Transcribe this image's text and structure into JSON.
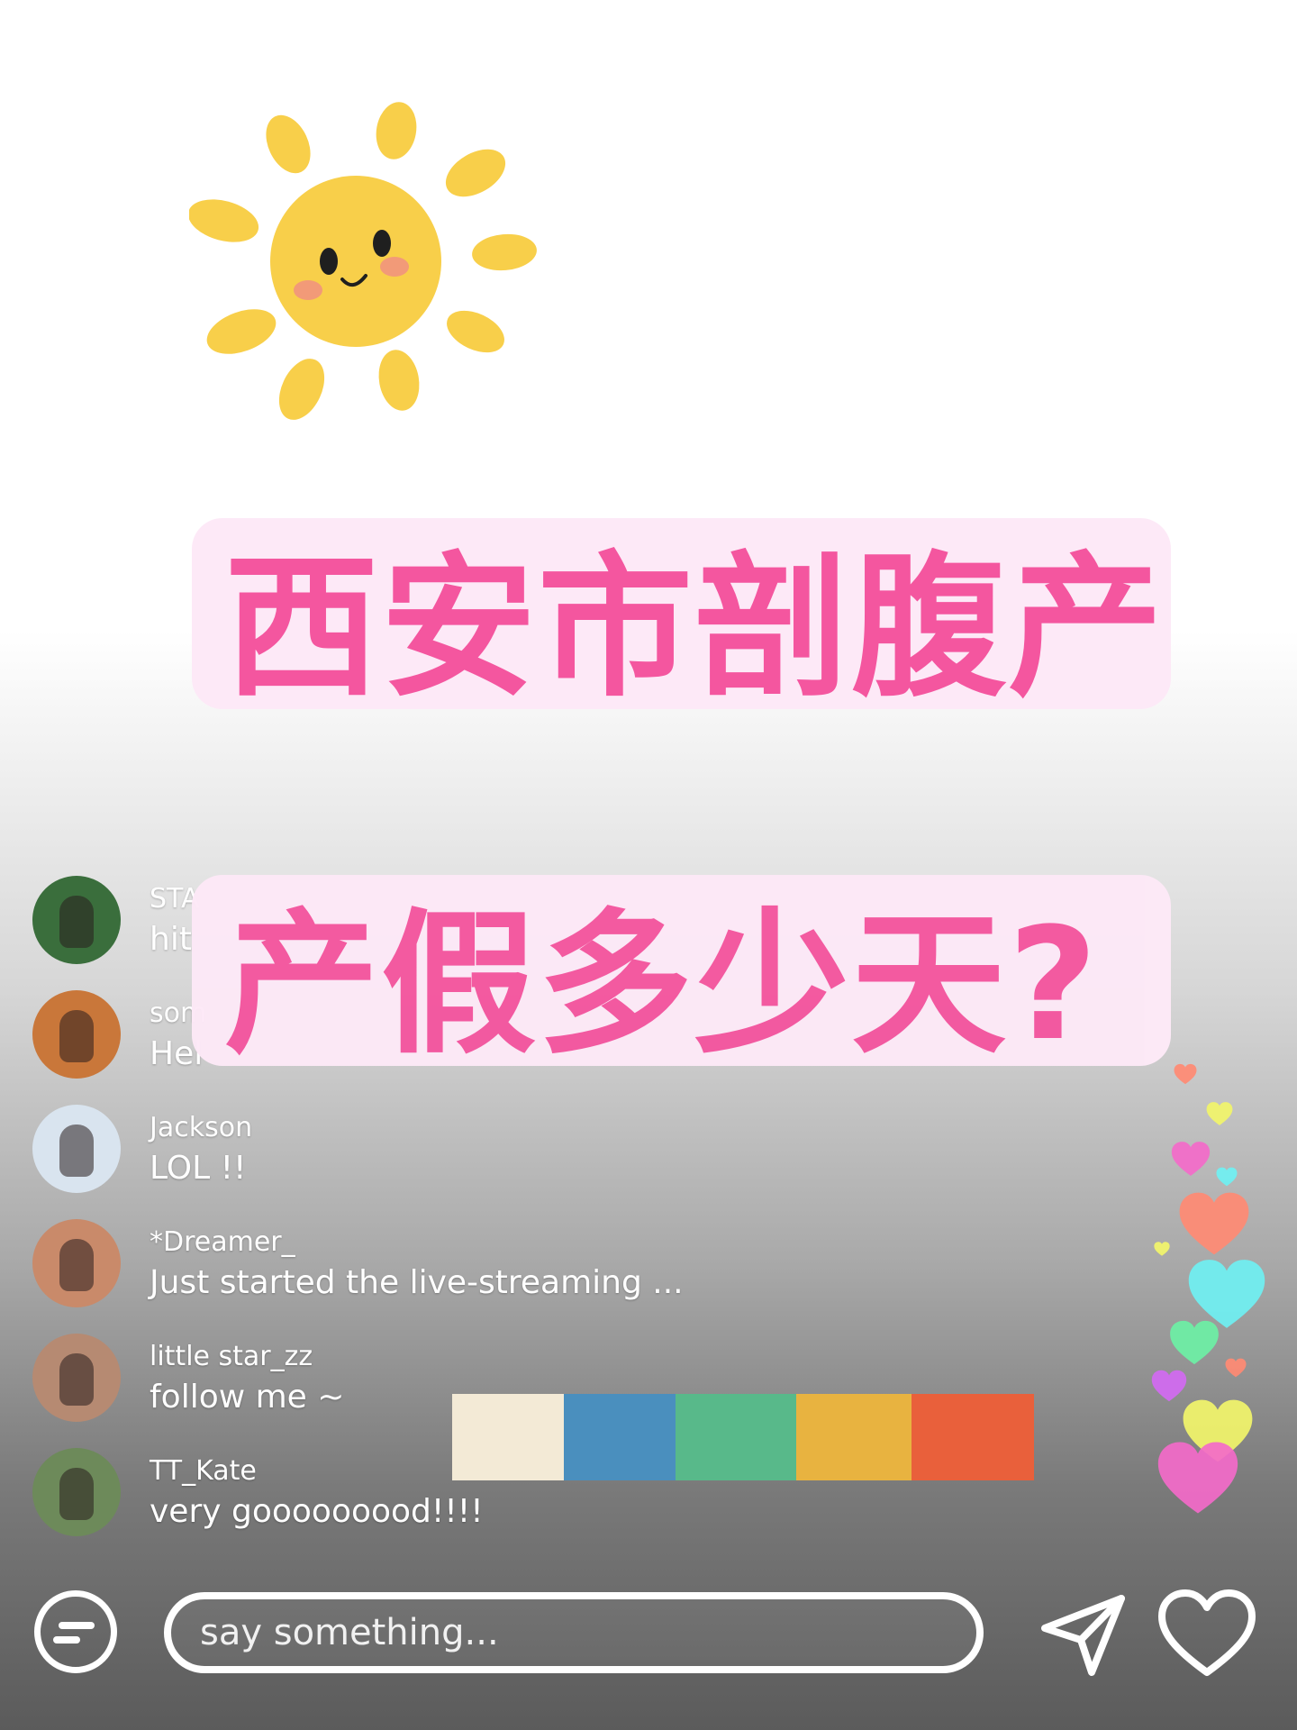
{
  "headline": {
    "line1": "西安市剖腹产",
    "line2": "产假多少天?"
  },
  "comments": [
    {
      "user": "STA",
      "message": "hit",
      "avatar_color": "#3a6e3c"
    },
    {
      "user": "som",
      "message": "Hel",
      "avatar_color": "#c9773a"
    },
    {
      "user": "Jackson",
      "message": "LOL !!",
      "avatar_color": "#d9e4ef"
    },
    {
      "user": "*Dreamer_",
      "message": "Just started the live-streaming ...",
      "avatar_color": "#c98a6a"
    },
    {
      "user": "little star_zz",
      "message": "follow me ~",
      "avatar_color": "#b68a72"
    },
    {
      "user": "TT_Kate",
      "message": "very gooooooood!!!!",
      "avatar_color": "#6d8a5a"
    }
  ],
  "swatch_colors": [
    "#f3ead6",
    "#4a8fbe",
    "#58b98a",
    "#e8b340",
    "#e9603b"
  ],
  "input": {
    "placeholder": "say something..."
  },
  "icons": {
    "chat": "chat-bubble-icon",
    "send": "send-arrow-icon",
    "like": "heart-outline-icon",
    "decor": "sun-illustration"
  },
  "colors": {
    "headline_text": "#f4569f",
    "headline_bg": "#fde9f7",
    "sun": "#f8cf4a"
  },
  "hearts": [
    {
      "color": "#ff8a73"
    },
    {
      "color": "#f2f56a"
    },
    {
      "color": "#f36ac9"
    },
    {
      "color": "#6ff0f2"
    },
    {
      "color": "#ff8a73"
    },
    {
      "color": "#f2f56a"
    },
    {
      "color": "#6ff0f2"
    },
    {
      "color": "#6cf0a5"
    },
    {
      "color": "#ff8a73"
    },
    {
      "color": "#d36af2"
    },
    {
      "color": "#f2f56a"
    },
    {
      "color": "#f36ac9"
    }
  ]
}
